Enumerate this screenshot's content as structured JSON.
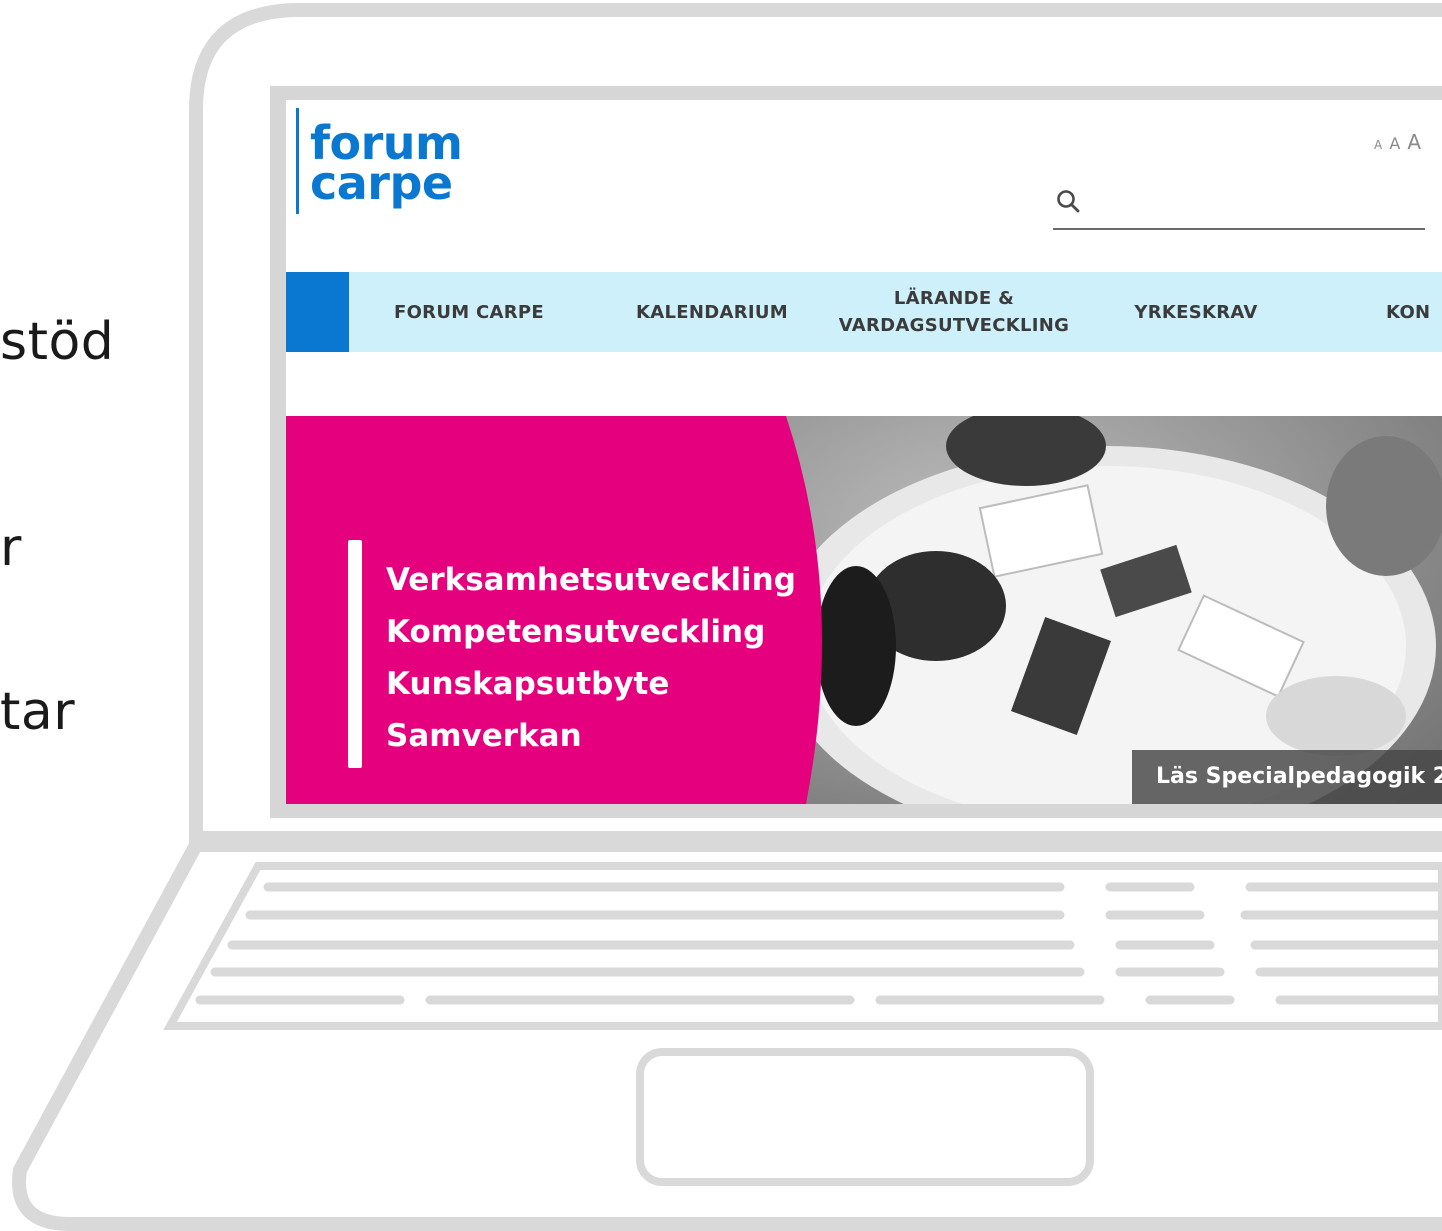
{
  "side_texts": [
    "stöd",
    "r",
    "tar"
  ],
  "site": {
    "logo_lines": [
      "forum",
      "carpe"
    ],
    "font_size_control": [
      "A",
      "A",
      "A"
    ],
    "search": {
      "placeholder": "",
      "value": "",
      "icon": "search-icon"
    },
    "nav": {
      "items": [
        "FORUM CARPE",
        "KALENDARIUM",
        "LÄRANDE &\nVARDAGSUTVECKLING",
        "YRKESKRAV",
        "KON"
      ]
    },
    "hero": {
      "lines": [
        "Verksamhetsutveckling",
        "Kompetensutveckling",
        "Kunskapsutbyte",
        "Samverkan"
      ],
      "caption": "Läs Specialpedagogik 2"
    }
  },
  "colors": {
    "brand_blue": "#0a78d0",
    "nav_background": "#cdf0fb",
    "hero_pink": "#e5007d",
    "laptop_outline": "#d9d9d9"
  }
}
